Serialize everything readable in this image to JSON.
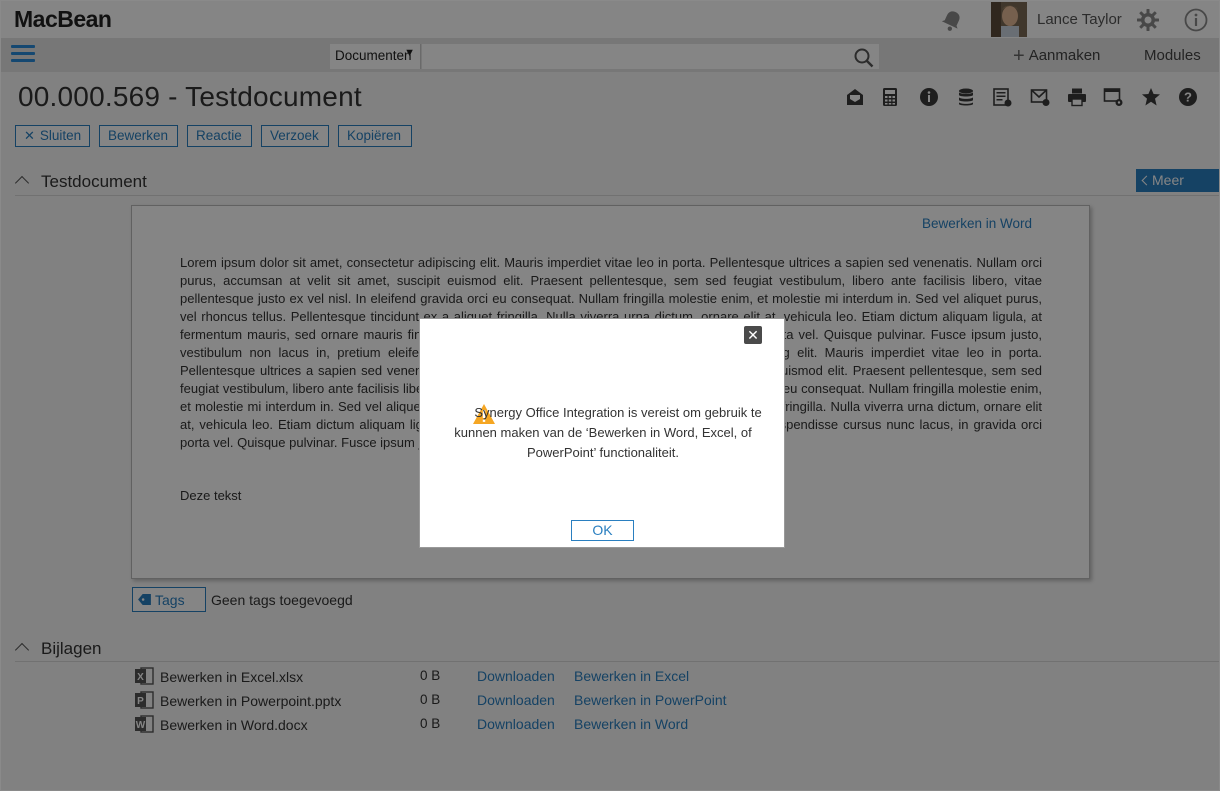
{
  "header": {
    "logo": "MacBean",
    "user_name": "Lance Taylor"
  },
  "nav": {
    "search_scope": "Documenten",
    "search_placeholder": "",
    "create_label": "Aanmaken",
    "modules_label": "Modules"
  },
  "document": {
    "title": "00.000.569 - Testdocument",
    "buttons": [
      "Sluiten",
      "Bewerken",
      "Reactie",
      "Verzoek",
      "Kopiëren"
    ],
    "toolbar_icons": [
      "mail-open-icon",
      "calculator-icon",
      "info-icon",
      "database-icon",
      "document-list-icon",
      "email-icon",
      "print-icon",
      "document-settings-icon",
      "star-icon",
      "help-icon"
    ],
    "section_title": "Testdocument",
    "more_label": "Meer",
    "edit_in_word": "Bewerken in Word",
    "body_text": "Lorem ipsum dolor sit amet, consectetur adipiscing elit. Mauris imperdiet vitae leo in porta. Pellentesque ultrices a sapien sed venenatis. Nullam orci purus, accumsan at velit sit amet, suscipit euismod elit. Praesent pellentesque, sem sed feugiat vestibulum, libero ante facilisis libero, vitae pellentesque justo ex vel nisl. In eleifend gravida orci eu consequat. Nullam fringilla molestie enim, et molestie mi interdum in. Sed vel aliquet purus, vel rhoncus tellus. Pellentesque tincidunt ex a aliquet fringilla. Nulla viverra urna dictum, ornare elit at, vehicula leo. Etiam dictum aliquam ligula, at fermentum mauris, sed ornare mauris finibus nec. Suspendisse cursus nunc lacus, in gravida orci porta vel. Quisque pulvinar. Fusce ipsum justo, vestibulum non lacus in, pretium eleifend ligula.Lorem ipsum dolor sit amet, consectetur adipiscing elit. Mauris imperdiet vitae leo in porta. Pellentesque ultrices a sapien sed venenatis. Nullam orci purus, accumsan at velit sit amet, suscipit euismod elit. Praesent pellentesque, sem sed feugiat vestibulum, libero ante facilisis libero, vitae pellentesque justo ex vel nisl. In eleifend gravida orci eu consequat. Nullam fringilla molestie enim, et molestie mi interdum in. Sed vel aliquet purus, vel rhoncus tellus. Pellentesque tincidunt ex a aliquet fringilla. Nulla viverra urna dictum, ornare elit at, vehicula leo. Etiam dictum aliquam ligula, at fermentum mauris, sed ornare mauris finibus nec. Suspendisse cursus nunc lacus, in gravida orci porta vel. Quisque pulvinar. Fusce ipsum justo, vestibulum non lacus in, pretium eleifend ligula.",
    "extra_line": "Deze tekst",
    "tags_label": "Tags",
    "no_tags": "Geen tags toegevoegd"
  },
  "attachments": {
    "section_title": "Bijlagen",
    "items": [
      {
        "name": "Bewerken in Excel.xlsx",
        "size": "0 B",
        "download": "Downloaden",
        "edit": "Bewerken in Excel",
        "icon": "excel-file-icon",
        "color": "#555555"
      },
      {
        "name": "Bewerken in Powerpoint.pptx",
        "size": "0 B",
        "download": "Downloaden",
        "edit": "Bewerken in PowerPoint",
        "icon": "powerpoint-file-icon",
        "color": "#555555"
      },
      {
        "name": "Bewerken in Word.docx",
        "size": "0 B",
        "download": "Downloaden",
        "edit": "Bewerken in Word",
        "icon": "word-file-icon",
        "color": "#555555"
      }
    ]
  },
  "modal": {
    "message": "Synergy Office Integration is vereist om gebruik te kunnen maken van de ‘Bewerken in Word, Excel, of PowerPoint’ functionaliteit.",
    "ok_label": "OK"
  },
  "colors": {
    "accent": "#2a7fc0",
    "warning": "#f5a623",
    "overlay": "rgba(0,0,0,0.48)"
  }
}
